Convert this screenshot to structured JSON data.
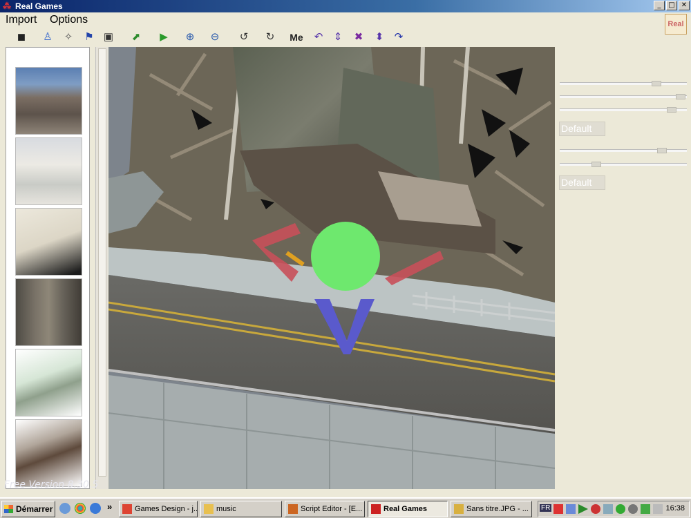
{
  "window": {
    "title": "Real Games",
    "minimize": "_",
    "maximize": "□",
    "close": "✕"
  },
  "menu": {
    "import": "Import",
    "options": "Options"
  },
  "toolbar": [
    {
      "name": "cube-icon",
      "glyph": "◼",
      "color": "#222"
    },
    {
      "name": "character-icon",
      "glyph": "♙",
      "color": "#3366cc"
    },
    {
      "name": "magic-wand-icon",
      "glyph": "✧",
      "color": "#555"
    },
    {
      "name": "flag-icon",
      "glyph": "⚑",
      "color": "#2244aa"
    },
    {
      "name": "save-icon",
      "glyph": "▣",
      "color": "#333"
    },
    {
      "name": "export-icon",
      "glyph": "⬈",
      "color": "#2a8a2a"
    },
    {
      "name": "play-icon",
      "glyph": "▶",
      "color": "#2a9a2a"
    },
    {
      "name": "zoom-in-icon",
      "glyph": "⊕",
      "color": "#2255aa"
    },
    {
      "name": "zoom-out-icon",
      "glyph": "⊖",
      "color": "#2255aa"
    },
    {
      "name": "rotate-left-icon",
      "glyph": "↺",
      "color": "#333"
    },
    {
      "name": "rotate-right-icon",
      "glyph": "↻",
      "color": "#333"
    },
    {
      "name": "me-icon",
      "glyph": "Me",
      "color": "#222"
    },
    {
      "name": "undo-icon",
      "glyph": "↶",
      "color": "#5533aa"
    },
    {
      "name": "vertical-arrows-icon",
      "glyph": "⇕",
      "color": "#5533aa"
    },
    {
      "name": "stop-icon",
      "glyph": "✖",
      "color": "#7a2aa0"
    },
    {
      "name": "up-down-icon",
      "glyph": "⬍",
      "color": "#5533aa"
    },
    {
      "name": "redo-icon",
      "glyph": "↷",
      "color": "#2233aa"
    }
  ],
  "right_panel": {
    "default_btn_1": "Default",
    "default_btn_2": "Default",
    "sliders": [
      0.78,
      0.99,
      0.91,
      0.83,
      0.27
    ]
  },
  "watermark": "Free Version 8.30.5",
  "taskbar": {
    "start": "Démarrer",
    "chevron": "»",
    "buttons": [
      {
        "label": "Games Design - j...",
        "icon_color": "#dd4433"
      },
      {
        "label": "music",
        "icon_color": "#e8c050"
      },
      {
        "label": "Script Editor - [E...",
        "icon_color": "#cc6622"
      },
      {
        "label": "Real Games",
        "icon_color": "#cc2222",
        "active": true
      },
      {
        "label": "Sans titre.JPG - ...",
        "icon_color": "#d8b040"
      }
    ],
    "lang": "FR",
    "clock": "16:38"
  },
  "logo_text": "Real"
}
